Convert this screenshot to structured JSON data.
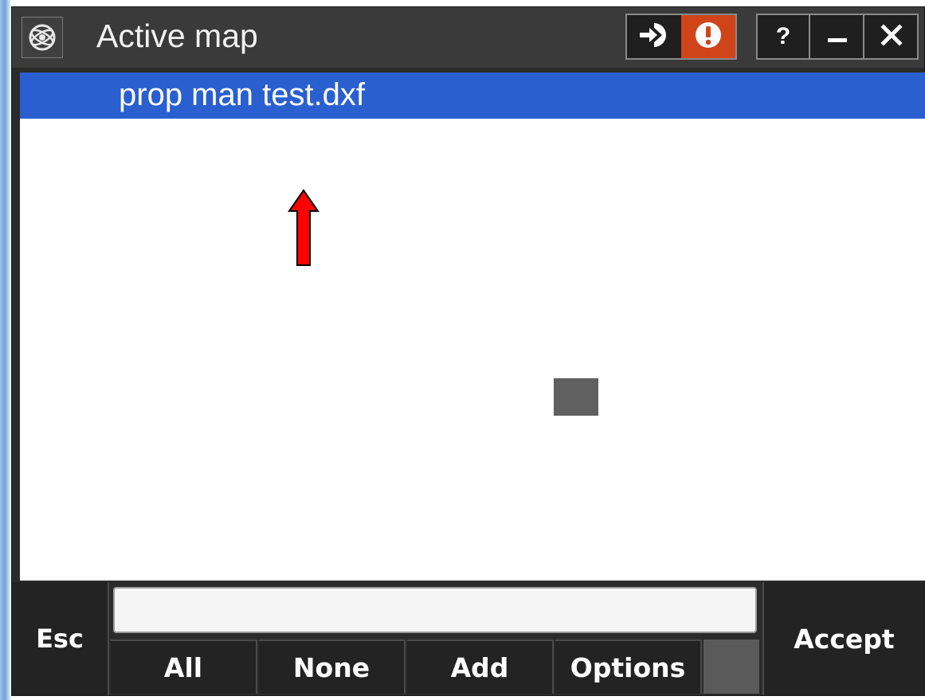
{
  "window": {
    "title": "Active map",
    "buttons": {
      "help_label": "?"
    }
  },
  "list": {
    "items": [
      {
        "label": "prop man test.dxf",
        "selected": true
      }
    ]
  },
  "toolbar": {
    "esc_label": "Esc",
    "accept_label": "Accept",
    "softkeys": [
      "All",
      "None",
      "Add",
      "Options"
    ]
  },
  "colors": {
    "selection": "#2a5fcf",
    "warning": "#d0441a",
    "annotation_arrow": "#ff0000"
  },
  "icons": {
    "app": "app-logo-icon",
    "login": "login-arrow-icon",
    "warning": "warning-icon",
    "minimize": "minimize-icon",
    "close": "close-icon"
  }
}
